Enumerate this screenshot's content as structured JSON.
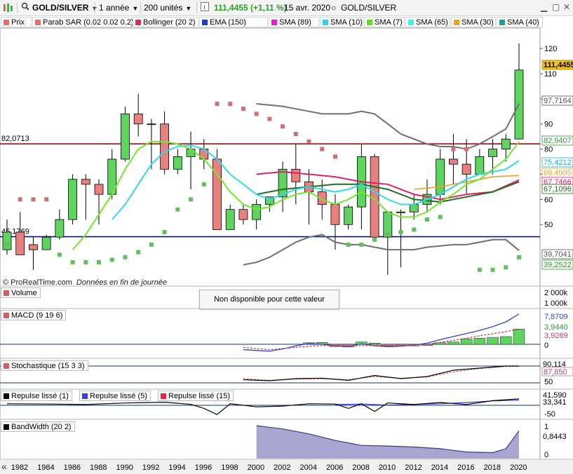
{
  "toolbar": {
    "instrument": "GOLD/SILVER",
    "period": "1 année",
    "units": "200 unités",
    "price": "111,4455",
    "change": "(+1,11 %)",
    "date": "15 avr. 2020",
    "instrument_right": "GOLD/SILVER"
  },
  "legend": [
    {
      "label": "Prix",
      "color": "#e07070"
    },
    {
      "label": "Parab SAR (0.02 0.02 0.2)",
      "color": "#e07070"
    },
    {
      "label": "Bollinger (20 2)",
      "color": "#cc3355"
    },
    {
      "label": "EMA (150)",
      "color": "#1a3fc0"
    },
    {
      "label": "SMA (89)",
      "color": "#e020c0"
    },
    {
      "label": "SMA (10)",
      "color": "#30d0f0"
    },
    {
      "label": "SMA (7)",
      "color": "#60e020"
    },
    {
      "label": "SMA (65)",
      "color": "#40f0e0"
    },
    {
      "label": "SMA (30)",
      "color": "#f0a020"
    },
    {
      "label": "SMA (40)",
      "color": "#20a090"
    }
  ],
  "hlines": {
    "red": "82,0713",
    "blue": "45,1769"
  },
  "attribution": {
    "brand": "© ProRealTime.com",
    "note": "Données en fin de journée"
  },
  "volume": {
    "label": "Volume",
    "na_text": "Non disponible pour cette valeur",
    "scale": [
      "2 000k",
      "1 000k",
      "0"
    ]
  },
  "macd": {
    "label": "MACD (9 19 6)",
    "scale": [
      "0"
    ],
    "values": [
      "7,8709",
      "3,9440",
      "3,9269"
    ]
  },
  "stoch": {
    "label": "Stochastique (15 3 3)",
    "scale": [
      "50"
    ],
    "values": [
      "90,114",
      "87,850"
    ]
  },
  "repulse": {
    "labels": [
      "Repulse lissé (1)",
      "Repulse lissé (5)",
      "Repulse lissé (15)"
    ],
    "colors": [
      "#000000",
      "#3344dd",
      "#ee2244"
    ],
    "scale": [
      "-50"
    ],
    "values": [
      "41,590",
      "33,341"
    ]
  },
  "bandwidth": {
    "label": "BandWidth (20 2)",
    "scale": [
      "1",
      "0"
    ],
    "values": [
      "0,8443"
    ]
  },
  "chart_data": {
    "type": "candlestick",
    "x": [
      1981,
      1982,
      1983,
      1984,
      1985,
      1986,
      1987,
      1988,
      1989,
      1990,
      1991,
      1992,
      1993,
      1994,
      1995,
      1996,
      1997,
      1998,
      1999,
      2000,
      2001,
      2002,
      2003,
      2004,
      2005,
      2006,
      2007,
      2008,
      2009,
      2010,
      2011,
      2012,
      2013,
      2014,
      2015,
      2016,
      2017,
      2018,
      2019,
      2020
    ],
    "open": [
      40,
      47,
      42,
      40,
      45,
      52,
      68,
      66,
      62,
      76,
      94,
      90,
      90,
      72,
      77,
      80,
      76,
      48,
      56,
      52,
      58,
      61,
      72,
      67,
      63,
      58,
      50,
      57,
      77,
      45,
      55,
      55,
      58,
      62,
      76,
      74,
      70,
      77,
      80,
      84
    ],
    "high": [
      52,
      55,
      45,
      46,
      56,
      70,
      70,
      68,
      80,
      97,
      102,
      92,
      95,
      80,
      87,
      84,
      80,
      58,
      58,
      60,
      60,
      75,
      82,
      72,
      68,
      62,
      58,
      82,
      78,
      46,
      56,
      62,
      68,
      80,
      86,
      84,
      80,
      84,
      86,
      122
    ],
    "low": [
      38,
      40,
      32,
      40,
      44,
      50,
      52,
      50,
      60,
      75,
      85,
      72,
      70,
      70,
      64,
      72,
      72,
      48,
      50,
      48,
      55,
      55,
      58,
      50,
      52,
      40,
      48,
      48,
      46,
      30,
      33,
      52,
      55,
      58,
      66,
      62,
      70,
      70,
      75,
      84
    ],
    "close": [
      47,
      38,
      40,
      45,
      52,
      68,
      66,
      62,
      76,
      94,
      90,
      90,
      72,
      77,
      80,
      76,
      48,
      56,
      52,
      58,
      61,
      72,
      67,
      63,
      58,
      50,
      57,
      77,
      45,
      55,
      55,
      58,
      62,
      76,
      74,
      70,
      77,
      80,
      84,
      111.4455
    ],
    "xticks": [
      "1982",
      "1984",
      "1986",
      "1988",
      "1990",
      "1992",
      "1994",
      "1996",
      "1998",
      "2000",
      "2002",
      "2004",
      "2006",
      "2008",
      "2010",
      "2012",
      "2014",
      "2016",
      "2018",
      "2020"
    ],
    "yticks": [
      50,
      60,
      70,
      80,
      90,
      100,
      110,
      120
    ],
    "ylim": [
      30,
      127
    ],
    "right_labels": [
      "111,4455",
      "97,7164",
      "82,9407",
      "75,4212",
      "69,4995",
      "67,7466",
      "67,1096",
      "39,7041",
      "39,2522"
    ],
    "sar": [
      [
        1981,
        42
      ],
      [
        1982,
        60
      ],
      [
        1983,
        60
      ],
      [
        1984,
        60
      ],
      [
        1985,
        38
      ],
      [
        1986,
        35
      ],
      [
        1987,
        35
      ],
      [
        1988,
        35
      ],
      [
        1989,
        36
      ],
      [
        1990,
        37
      ],
      [
        1991,
        39
      ],
      [
        1992,
        42
      ],
      [
        1993,
        47
      ],
      [
        1994,
        56
      ],
      [
        1995,
        60
      ],
      [
        1996,
        66
      ],
      [
        1997,
        98
      ],
      [
        1998,
        98
      ],
      [
        1999,
        96
      ],
      [
        2000,
        94
      ],
      [
        2001,
        92
      ],
      [
        2002,
        89
      ],
      [
        2003,
        86
      ],
      [
        2004,
        83
      ],
      [
        2005,
        80
      ],
      [
        2006,
        77
      ],
      [
        2007,
        42
      ],
      [
        2008,
        42
      ],
      [
        2009,
        44
      ],
      [
        2010,
        46
      ],
      [
        2011,
        47
      ],
      [
        2012,
        48
      ],
      [
        2013,
        52
      ],
      [
        2014,
        53
      ],
      [
        2015,
        80
      ],
      [
        2016,
        80
      ],
      [
        2017,
        32
      ],
      [
        2018,
        32
      ],
      [
        2019,
        33
      ],
      [
        2020,
        37
      ]
    ],
    "boll_upper": [
      [
        2000,
        98
      ],
      [
        2001,
        97.5
      ],
      [
        2002,
        97
      ],
      [
        2003,
        96
      ],
      [
        2004,
        95
      ],
      [
        2005,
        94
      ],
      [
        2006,
        94
      ],
      [
        2007,
        94
      ],
      [
        2008,
        95
      ],
      [
        2009,
        94
      ],
      [
        2010,
        90
      ],
      [
        2011,
        86
      ],
      [
        2012,
        84
      ],
      [
        2013,
        82
      ],
      [
        2014,
        81
      ],
      [
        2015,
        81
      ],
      [
        2016,
        80
      ],
      [
        2017,
        82
      ],
      [
        2018,
        85
      ],
      [
        2019,
        88
      ],
      [
        2020,
        98
      ]
    ],
    "boll_lower": [
      [
        1999,
        34
      ],
      [
        2000,
        35
      ],
      [
        2001,
        37
      ],
      [
        2002,
        40
      ],
      [
        2003,
        43
      ],
      [
        2004,
        45
      ],
      [
        2005,
        46
      ],
      [
        2006,
        43
      ],
      [
        2007,
        42
      ],
      [
        2008,
        42
      ],
      [
        2009,
        41
      ],
      [
        2010,
        40
      ],
      [
        2011,
        40
      ],
      [
        2012,
        40
      ],
      [
        2013,
        41
      ],
      [
        2014,
        41.5
      ],
      [
        2015,
        42
      ],
      [
        2016,
        42
      ],
      [
        2017,
        43
      ],
      [
        2018,
        44
      ],
      [
        2019,
        44
      ],
      [
        2020,
        39.7
      ]
    ],
    "ema150": [
      [
        2000,
        62
      ],
      [
        2002,
        64
      ],
      [
        2004,
        65
      ],
      [
        2006,
        66
      ],
      [
        2008,
        66
      ],
      [
        2010,
        64
      ],
      [
        2012,
        60
      ],
      [
        2014,
        59
      ],
      [
        2016,
        61
      ],
      [
        2018,
        63
      ],
      [
        2020,
        67
      ]
    ],
    "sma89": [
      [
        2000,
        70
      ],
      [
        2002,
        71
      ],
      [
        2004,
        70
      ],
      [
        2006,
        69
      ],
      [
        2008,
        67
      ],
      [
        2010,
        66
      ],
      [
        2012,
        62
      ],
      [
        2014,
        60
      ],
      [
        2016,
        62
      ],
      [
        2018,
        63
      ],
      [
        2020,
        67.7
      ]
    ],
    "sma30": [
      [
        2012,
        64
      ],
      [
        2014,
        65
      ],
      [
        2016,
        67
      ],
      [
        2018,
        69
      ],
      [
        2020,
        69.5
      ]
    ],
    "sma10": [
      [
        1989,
        52
      ],
      [
        1990,
        58
      ],
      [
        1991,
        66
      ],
      [
        1992,
        74
      ],
      [
        1993,
        79
      ],
      [
        1994,
        81
      ],
      [
        1995,
        81.5
      ],
      [
        1996,
        80
      ],
      [
        1997,
        76
      ],
      [
        1998,
        70
      ],
      [
        1999,
        66
      ],
      [
        2000,
        62
      ],
      [
        2001,
        60
      ],
      [
        2002,
        62
      ],
      [
        2003,
        64
      ],
      [
        2004,
        65
      ],
      [
        2005,
        64
      ],
      [
        2006,
        63
      ],
      [
        2007,
        64
      ],
      [
        2008,
        66
      ],
      [
        2009,
        63
      ],
      [
        2010,
        60
      ],
      [
        2011,
        58
      ],
      [
        2012,
        58
      ],
      [
        2013,
        60
      ],
      [
        2014,
        62
      ],
      [
        2015,
        65
      ],
      [
        2016,
        68
      ],
      [
        2017,
        70
      ],
      [
        2018,
        71
      ],
      [
        2019,
        72
      ],
      [
        2020,
        75.4
      ]
    ],
    "sma7": [
      [
        1986,
        40
      ],
      [
        1987,
        46
      ],
      [
        1988,
        54
      ],
      [
        1989,
        62
      ],
      [
        1990,
        72
      ],
      [
        1991,
        80
      ],
      [
        1992,
        83
      ],
      [
        1993,
        83
      ],
      [
        1994,
        82
      ],
      [
        1995,
        80
      ],
      [
        1996,
        76
      ],
      [
        1997,
        70
      ],
      [
        1998,
        63
      ],
      [
        1999,
        58
      ],
      [
        2000,
        56
      ],
      [
        2001,
        57
      ],
      [
        2002,
        60
      ],
      [
        2003,
        62
      ],
      [
        2004,
        63
      ],
      [
        2005,
        60
      ],
      [
        2006,
        58
      ],
      [
        2007,
        60
      ],
      [
        2008,
        63
      ],
      [
        2009,
        60
      ],
      [
        2010,
        55
      ],
      [
        2011,
        53
      ],
      [
        2012,
        53
      ],
      [
        2013,
        55
      ],
      [
        2014,
        59
      ],
      [
        2015,
        62
      ],
      [
        2016,
        66
      ],
      [
        2017,
        68
      ],
      [
        2018,
        72
      ],
      [
        2019,
        76
      ],
      [
        2020,
        82.9
      ]
    ],
    "macd": [
      [
        1999,
        -1.4
      ],
      [
        2000,
        -1.6
      ],
      [
        2001,
        -1.8
      ],
      [
        2002,
        -1.2
      ],
      [
        2003,
        -0.4
      ],
      [
        2004,
        0.2
      ],
      [
        2005,
        0
      ],
      [
        2006,
        -0.4
      ],
      [
        2007,
        -0.6
      ],
      [
        2008,
        0.1
      ],
      [
        2009,
        -0.4
      ],
      [
        2010,
        -0.6
      ],
      [
        2011,
        -0.5
      ],
      [
        2012,
        -0.2
      ],
      [
        2013,
        0.3
      ],
      [
        2014,
        1.2
      ],
      [
        2015,
        2
      ],
      [
        2016,
        2.8
      ],
      [
        2017,
        3.6
      ],
      [
        2018,
        4.6
      ],
      [
        2019,
        5.8
      ],
      [
        2020,
        7.87
      ]
    ],
    "macd_signal": [
      [
        1999,
        -0.8
      ],
      [
        2001,
        -1.4
      ],
      [
        2003,
        -0.8
      ],
      [
        2005,
        -0.3
      ],
      [
        2007,
        -0.4
      ],
      [
        2009,
        -0.3
      ],
      [
        2011,
        -0.4
      ],
      [
        2013,
        0
      ],
      [
        2015,
        1
      ],
      [
        2017,
        2.2
      ],
      [
        2019,
        3.3
      ],
      [
        2020,
        3.93
      ]
    ],
    "macd_hist": [
      [
        2004,
        0.4
      ],
      [
        2005,
        0.5
      ],
      [
        2006,
        -0.6
      ],
      [
        2007,
        -0.7
      ],
      [
        2008,
        0.6
      ],
      [
        2009,
        0.3
      ],
      [
        2010,
        -0.4
      ],
      [
        2011,
        -0.3
      ],
      [
        2012,
        -0.4
      ],
      [
        2013,
        -0.3
      ],
      [
        2014,
        0.4
      ],
      [
        2015,
        0.6
      ],
      [
        2016,
        1.4
      ],
      [
        2017,
        1.6
      ],
      [
        2018,
        1.8
      ],
      [
        2019,
        2
      ],
      [
        2020,
        3.94
      ]
    ],
    "stoch_k": [
      [
        1999,
        25
      ],
      [
        2001,
        20
      ],
      [
        2003,
        30
      ],
      [
        2005,
        32
      ],
      [
        2007,
        22
      ],
      [
        2009,
        45
      ],
      [
        2011,
        30
      ],
      [
        2013,
        40
      ],
      [
        2015,
        70
      ],
      [
        2017,
        80
      ],
      [
        2019,
        90
      ],
      [
        2020,
        90.1
      ]
    ],
    "stoch_d": [
      [
        1999,
        30
      ],
      [
        2001,
        22
      ],
      [
        2003,
        28
      ],
      [
        2005,
        30
      ],
      [
        2007,
        25
      ],
      [
        2009,
        40
      ],
      [
        2011,
        32
      ],
      [
        2013,
        38
      ],
      [
        2015,
        62
      ],
      [
        2017,
        78
      ],
      [
        2019,
        88
      ],
      [
        2020,
        87.85
      ]
    ],
    "repulse1": [
      [
        1981,
        10
      ],
      [
        1984,
        8
      ],
      [
        1987,
        5
      ],
      [
        1990,
        15
      ],
      [
        1993,
        20
      ],
      [
        1995,
        6
      ],
      [
        1996,
        -20
      ],
      [
        1997,
        -60
      ],
      [
        1998,
        10
      ],
      [
        2000,
        -10
      ],
      [
        2002,
        -5
      ],
      [
        2004,
        10
      ],
      [
        2006,
        8
      ],
      [
        2007,
        -20
      ],
      [
        2008,
        10
      ],
      [
        2009,
        -40
      ],
      [
        2010,
        15
      ],
      [
        2012,
        5
      ],
      [
        2014,
        18
      ],
      [
        2016,
        5
      ],
      [
        2018,
        30
      ],
      [
        2020,
        41.59
      ]
    ],
    "repulse5": [
      [
        2006,
        5
      ],
      [
        2008,
        8
      ],
      [
        2010,
        2
      ],
      [
        2012,
        6
      ],
      [
        2014,
        10
      ],
      [
        2016,
        18
      ],
      [
        2018,
        28
      ],
      [
        2020,
        33.34
      ]
    ],
    "bandwidth_vals": [
      [
        2000,
        1
      ],
      [
        2002,
        0.9
      ],
      [
        2004,
        0.75
      ],
      [
        2006,
        0.55
      ],
      [
        2008,
        0.4
      ],
      [
        2010,
        0.38
      ],
      [
        2012,
        0.35
      ],
      [
        2014,
        0.3
      ],
      [
        2016,
        0.2
      ],
      [
        2018,
        0.18
      ],
      [
        2019,
        0.3
      ],
      [
        2020,
        0.8443
      ]
    ]
  }
}
